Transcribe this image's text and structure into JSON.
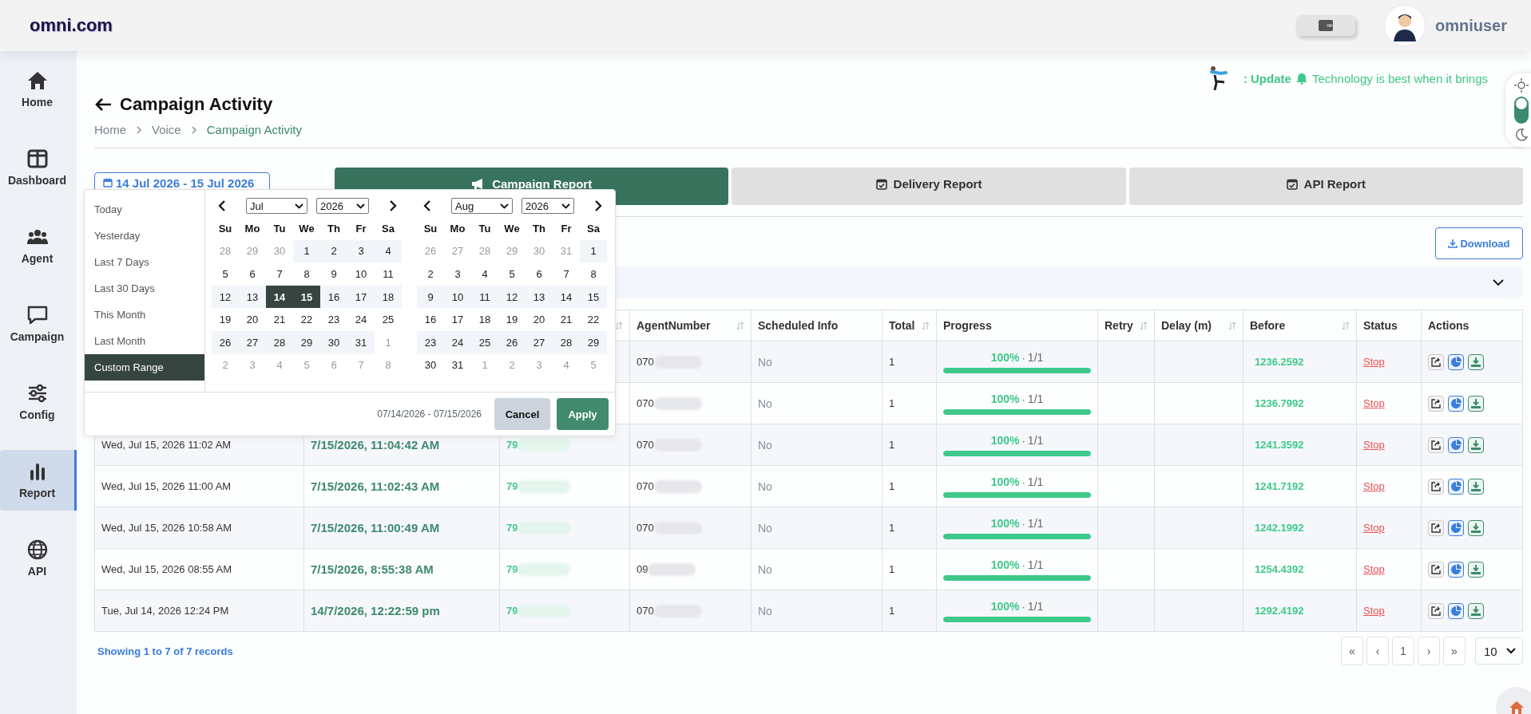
{
  "header": {
    "logo": "omni.com",
    "username": "omniuser"
  },
  "sidebar": {
    "items": [
      {
        "label": "Home",
        "selected": false
      },
      {
        "label": "Dashboard",
        "selected": false
      },
      {
        "label": "Agent",
        "selected": false
      },
      {
        "label": "Campaign",
        "selected": false
      },
      {
        "label": "Config",
        "selected": false
      },
      {
        "label": "Report",
        "selected": true
      },
      {
        "label": "API",
        "selected": false
      }
    ]
  },
  "ticker": {
    "label": ": Update",
    "text": "Technology is best when it brings"
  },
  "theme_toggle": {
    "dark": false
  },
  "page": {
    "title": "Campaign Activity",
    "breadcrumb": [
      {
        "label": "Home",
        "current": false
      },
      {
        "label": "Voice",
        "current": false
      },
      {
        "label": "Campaign Activity",
        "current": true
      }
    ]
  },
  "date_range": {
    "value": "14 Jul 2026 - 15 Jul 2026"
  },
  "tabs": [
    {
      "label": "Campaign Report",
      "selected": true
    },
    {
      "label": "Delivery Report",
      "selected": false
    },
    {
      "label": "API Report",
      "selected": false
    }
  ],
  "download_button": "Download",
  "filter_bar": {
    "expanded": false
  },
  "table": {
    "columns": [
      {
        "sortable": true
      },
      {
        "label": "AgentNumber",
        "sortable": true
      },
      {
        "label": "Scheduled Info",
        "sortable": false
      },
      {
        "label": "Total",
        "sortable": true
      },
      {
        "label": "Progress",
        "sortable": false
      },
      {
        "label": "Retry",
        "sortable": true
      },
      {
        "label": "Delay (m)",
        "sortable": true
      },
      {
        "label": "Before",
        "sortable": true
      },
      {
        "label": "Status",
        "sortable": false
      },
      {
        "label": "Actions",
        "sortable": false
      }
    ],
    "rows": [
      {
        "agent": "070",
        "scheduled": "No",
        "total": "1",
        "percent": "100%",
        "separator": "·",
        "count": "1/1",
        "level": 1,
        "before": "1236.2592",
        "status": "Stop"
      },
      {
        "agent": "070",
        "scheduled": "No",
        "total": "1",
        "percent": "100%",
        "separator": "·",
        "count": "1/1",
        "level": 1,
        "before": "1236.7992",
        "status": "Stop"
      },
      {
        "created": "Wed, Jul 15, 2026 11:02 AM",
        "time": "7/15/2026, 11:04:42 AM",
        "number": "79",
        "agent": "070",
        "scheduled": "No",
        "total": "1",
        "percent": "100%",
        "separator": "·",
        "count": "1/1",
        "level": 1,
        "before": "1241.3592",
        "status": "Stop"
      },
      {
        "created": "Wed, Jul 15, 2026 11:00 AM",
        "time": "7/15/2026, 11:02:43 AM",
        "number": "79",
        "agent": "070",
        "scheduled": "No",
        "total": "1",
        "percent": "100%",
        "separator": "·",
        "count": "1/1",
        "level": 1,
        "before": "1241.7192",
        "status": "Stop"
      },
      {
        "created": "Wed, Jul 15, 2026 10:58 AM",
        "time": "7/15/2026, 11:00:49 AM",
        "number": "79",
        "agent": "070",
        "scheduled": "No",
        "total": "1",
        "percent": "100%",
        "separator": "·",
        "count": "1/1",
        "level": 1,
        "before": "1242.1992",
        "status": "Stop"
      },
      {
        "created": "Wed, Jul 15, 2026 08:55 AM",
        "time": "7/15/2026, 8:55:38 AM",
        "number": "79",
        "agent": "09",
        "scheduled": "No",
        "total": "1",
        "percent": "100%",
        "separator": "·",
        "count": "1/1",
        "level": 1,
        "before": "1254.4392",
        "status": "Stop"
      },
      {
        "created": "Tue, Jul 14, 2026 12:24 PM",
        "time": "14/7/2026, 12:22:59 pm",
        "number": "79",
        "agent": "070",
        "scheduled": "No",
        "total": "1",
        "percent": "100%",
        "separator": "·",
        "count": "1/1",
        "level": 1,
        "before": "1292.4192",
        "status": "Stop"
      }
    ]
  },
  "footer": {
    "showing": "Showing 1 to 7 of 7 records",
    "pages": [
      {
        "label": "«",
        "selected": false
      },
      {
        "label": "‹",
        "selected": false
      },
      {
        "label": "1",
        "selected": false
      },
      {
        "label": "›",
        "selected": false
      },
      {
        "label": "»",
        "selected": false
      }
    ],
    "page_size": "10"
  },
  "date_picker": {
    "ranges": [
      {
        "label": "Today",
        "selected": false
      },
      {
        "label": "Yesterday",
        "selected": false
      },
      {
        "label": "Last 7 Days",
        "selected": false
      },
      {
        "label": "Last 30 Days",
        "selected": false
      },
      {
        "label": "This Month",
        "selected": false
      },
      {
        "label": "Last Month",
        "selected": false
      },
      {
        "label": "Custom Range",
        "selected": true
      }
    ],
    "calendars": [
      {
        "month": "Jul",
        "year": "2026",
        "weekdays": [
          "Su",
          "Mo",
          "Tu",
          "We",
          "Th",
          "Fr",
          "Sa"
        ],
        "weeks": [
          [
            {
              "d": "28",
              "off": true,
              "selected": false
            },
            {
              "d": "29",
              "off": true,
              "selected": false
            },
            {
              "d": "30",
              "off": true,
              "selected": false
            },
            {
              "d": "1",
              "off": false,
              "selected": false
            },
            {
              "d": "2",
              "off": false,
              "selected": false
            },
            {
              "d": "3",
              "off": false,
              "selected": false
            },
            {
              "d": "4",
              "off": false,
              "selected": false
            }
          ],
          [
            {
              "d": "5",
              "off": false,
              "selected": false
            },
            {
              "d": "6",
              "off": false,
              "selected": false
            },
            {
              "d": "7",
              "off": false,
              "selected": false
            },
            {
              "d": "8",
              "off": false,
              "selected": false
            },
            {
              "d": "9",
              "off": false,
              "selected": false
            },
            {
              "d": "10",
              "off": false,
              "selected": false
            },
            {
              "d": "11",
              "off": false,
              "selected": false
            }
          ],
          [
            {
              "d": "12",
              "off": false,
              "selected": false
            },
            {
              "d": "13",
              "off": false,
              "selected": false
            },
            {
              "d": "14",
              "off": false,
              "selected": true
            },
            {
              "d": "15",
              "off": false,
              "selected": true
            },
            {
              "d": "16",
              "off": false,
              "selected": false
            },
            {
              "d": "17",
              "off": false,
              "selected": false
            },
            {
              "d": "18",
              "off": false,
              "selected": false
            }
          ],
          [
            {
              "d": "19",
              "off": false,
              "selected": false
            },
            {
              "d": "20",
              "off": false,
              "selected": false
            },
            {
              "d": "21",
              "off": false,
              "selected": false
            },
            {
              "d": "22",
              "off": false,
              "selected": false
            },
            {
              "d": "23",
              "off": false,
              "selected": false
            },
            {
              "d": "24",
              "off": false,
              "selected": false
            },
            {
              "d": "25",
              "off": false,
              "selected": false
            }
          ],
          [
            {
              "d": "26",
              "off": false,
              "selected": false
            },
            {
              "d": "27",
              "off": false,
              "selected": false
            },
            {
              "d": "28",
              "off": false,
              "selected": false
            },
            {
              "d": "29",
              "off": false,
              "selected": false
            },
            {
              "d": "30",
              "off": false,
              "selected": false
            },
            {
              "d": "31",
              "off": false,
              "selected": false
            },
            {
              "d": "1",
              "off": true,
              "selected": false
            }
          ],
          [
            {
              "d": "2",
              "off": true,
              "selected": false
            },
            {
              "d": "3",
              "off": true,
              "selected": false
            },
            {
              "d": "4",
              "off": true,
              "selected": false
            },
            {
              "d": "5",
              "off": true,
              "selected": false
            },
            {
              "d": "6",
              "off": true,
              "selected": false
            },
            {
              "d": "7",
              "off": true,
              "selected": false
            },
            {
              "d": "8",
              "off": true,
              "selected": false
            }
          ]
        ]
      },
      {
        "month": "Aug",
        "year": "2026",
        "weekdays": [
          "Su",
          "Mo",
          "Tu",
          "We",
          "Th",
          "Fr",
          "Sa"
        ],
        "weeks": [
          [
            {
              "d": "26",
              "off": true,
              "selected": false
            },
            {
              "d": "27",
              "off": true,
              "selected": false
            },
            {
              "d": "28",
              "off": true,
              "selected": false
            },
            {
              "d": "29",
              "off": true,
              "selected": false
            },
            {
              "d": "30",
              "off": true,
              "selected": false
            },
            {
              "d": "31",
              "off": true,
              "selected": false
            },
            {
              "d": "1",
              "off": false,
              "selected": false
            }
          ],
          [
            {
              "d": "2",
              "off": false,
              "selected": false
            },
            {
              "d": "3",
              "off": false,
              "selected": false
            },
            {
              "d": "4",
              "off": false,
              "selected": false
            },
            {
              "d": "5",
              "off": false,
              "selected": false
            },
            {
              "d": "6",
              "off": false,
              "selected": false
            },
            {
              "d": "7",
              "off": false,
              "selected": false
            },
            {
              "d": "8",
              "off": false,
              "selected": false
            }
          ],
          [
            {
              "d": "9",
              "off": false,
              "selected": false
            },
            {
              "d": "10",
              "off": false,
              "selected": false
            },
            {
              "d": "11",
              "off": false,
              "selected": false
            },
            {
              "d": "12",
              "off": false,
              "selected": false
            },
            {
              "d": "13",
              "off": false,
              "selected": false
            },
            {
              "d": "14",
              "off": false,
              "selected": false
            },
            {
              "d": "15",
              "off": false,
              "selected": false
            }
          ],
          [
            {
              "d": "16",
              "off": false,
              "selected": false
            },
            {
              "d": "17",
              "off": false,
              "selected": false
            },
            {
              "d": "18",
              "off": false,
              "selected": false
            },
            {
              "d": "19",
              "off": false,
              "selected": false
            },
            {
              "d": "20",
              "off": false,
              "selected": false
            },
            {
              "d": "21",
              "off": false,
              "selected": false
            },
            {
              "d": "22",
              "off": false,
              "selected": false
            }
          ],
          [
            {
              "d": "23",
              "off": false,
              "selected": false
            },
            {
              "d": "24",
              "off": false,
              "selected": false
            },
            {
              "d": "25",
              "off": false,
              "selected": false
            },
            {
              "d": "26",
              "off": false,
              "selected": false
            },
            {
              "d": "27",
              "off": false,
              "selected": false
            },
            {
              "d": "28",
              "off": false,
              "selected": false
            },
            {
              "d": "29",
              "off": false,
              "selected": false
            }
          ],
          [
            {
              "d": "30",
              "off": false,
              "selected": false
            },
            {
              "d": "31",
              "off": false,
              "selected": false
            },
            {
              "d": "1",
              "off": true,
              "selected": false
            },
            {
              "d": "2",
              "off": true,
              "selected": false
            },
            {
              "d": "3",
              "off": true,
              "selected": false
            },
            {
              "d": "4",
              "off": true,
              "selected": false
            },
            {
              "d": "5",
              "off": true,
              "selected": false
            }
          ]
        ]
      }
    ],
    "range_text": "07/14/2026 - 07/15/2026",
    "cancel": "Cancel",
    "apply": "Apply"
  }
}
